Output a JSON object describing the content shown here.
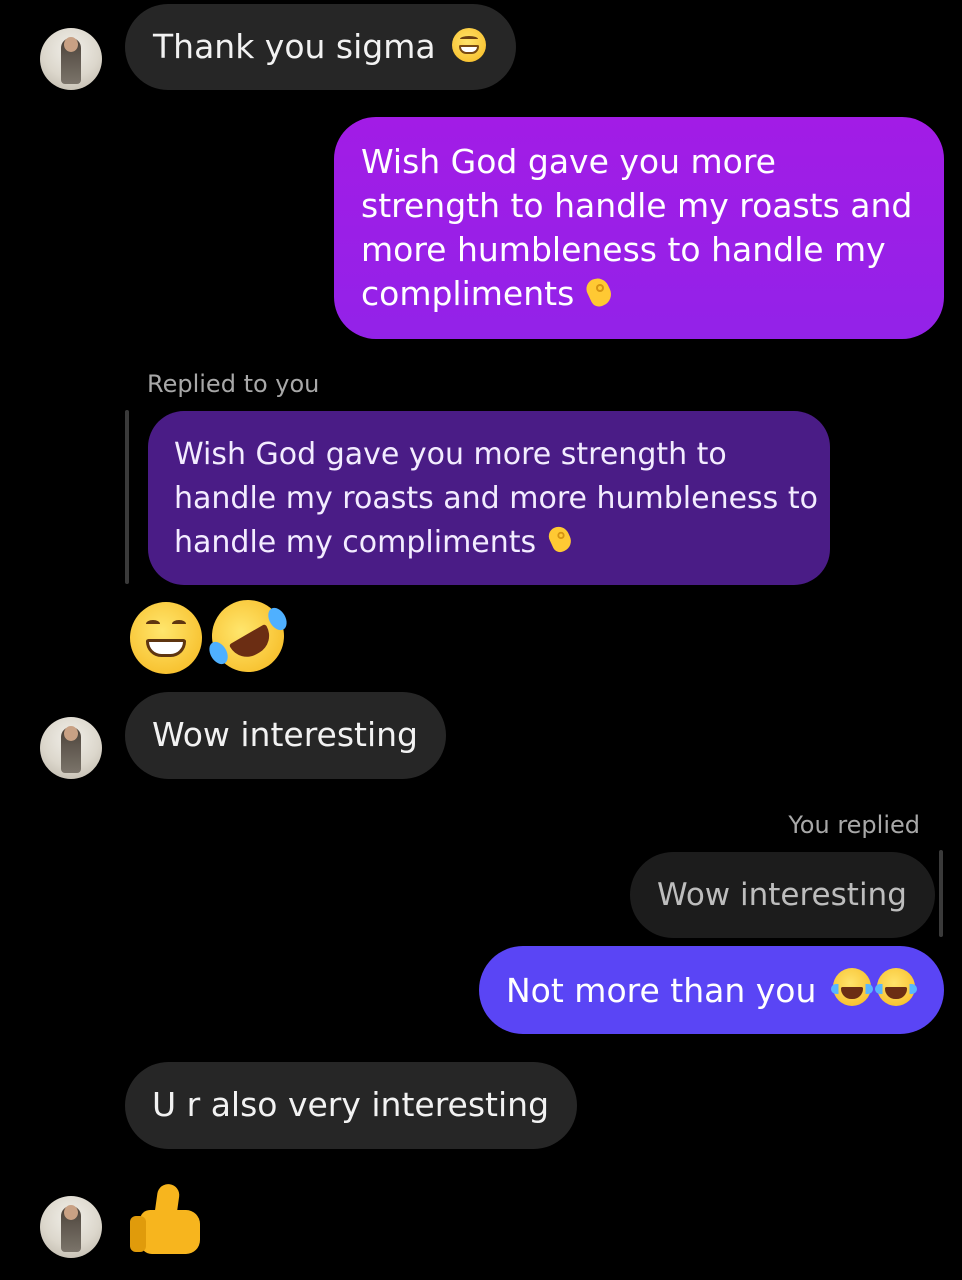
{
  "messages": {
    "m1": {
      "text": "Thank you sigma",
      "emoji": "grinning-face-with-smiling-eyes"
    },
    "m2": {
      "lines": [
        "Wish God gave you more",
        "strength to handle my roasts and",
        "more humbleness to handle my",
        "compliments"
      ],
      "emoji": "pinching-hand"
    },
    "reply1": {
      "label": "Replied to you",
      "lines": [
        "Wish God gave you more strength to",
        "handle my roasts and more humbleness to",
        "handle my compliments"
      ],
      "emoji": "pinching-hand"
    },
    "reaction_emojis": [
      "grinning-face-with-smiling-eyes",
      "rolling-on-the-floor-laughing"
    ],
    "m3": {
      "text": "Wow interesting"
    },
    "reply2": {
      "label": "You replied",
      "quoted": "Wow interesting"
    },
    "m4": {
      "text": "Not more than you",
      "emoji": "face-with-tears-of-joy"
    },
    "m5": {
      "text": "U r also very interesting"
    },
    "m6": {
      "emoji": "thumbs-up"
    }
  },
  "colors": {
    "background": "#000000",
    "received_bubble": "#262626",
    "sent_gradient_start": "#a21ce6",
    "sent_gradient_end": "#8a26ea",
    "reply_quote_bubble": "#4a1c86",
    "sent_blue": "#5a45f5",
    "secondary_text": "#a8a8a8"
  }
}
